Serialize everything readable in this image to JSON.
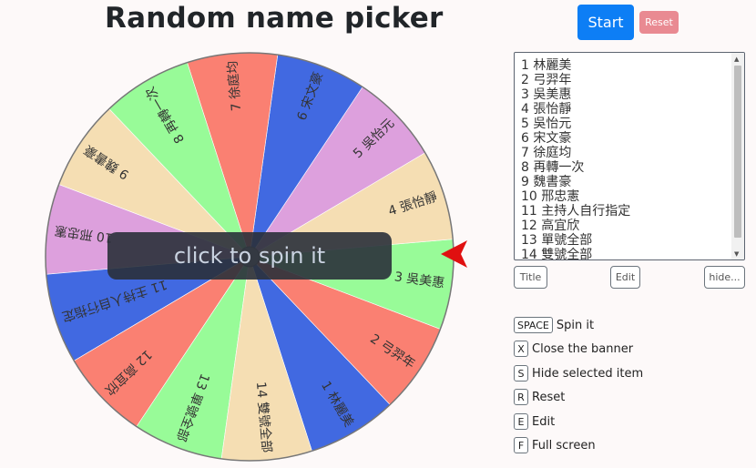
{
  "title": "Random name picker",
  "buttons": {
    "start": "Start",
    "reset": "Reset",
    "title": "Title",
    "edit": "Edit",
    "hide": "hide..."
  },
  "banner": "click to spin it",
  "names": [
    "林麗美",
    "弓羿年",
    "吳美惠",
    "張怡靜",
    "吳怡元",
    "宋文豪",
    "徐庭均",
    "再轉一次",
    "魏書豪",
    "邢忠憲",
    "主持人自行指定",
    "高宜欣",
    "單號全部",
    "雙號全部"
  ],
  "names_text": "1 林麗美\n2 弓羿年\n3 吳美惠\n4 張怡靜\n5 吳怡元\n6 宋文豪\n7 徐庭均\n8 再轉一次\n9 魏書豪\n10 邢忠憲\n11 主持人自行指定\n12 高宜欣\n13 單號全部\n14 雙號全部",
  "wheel": {
    "colors": [
      "#4169e1",
      "#fa8072",
      "#98fb98",
      "#f5deb3",
      "#dda0dd",
      "#4169e1",
      "#fa8072",
      "#98fb98",
      "#f5deb3",
      "#dda0dd",
      "#4169e1",
      "#fa8072",
      "#98fb98",
      "#f5deb3"
    ],
    "labels": [
      "1 林麗美",
      "2 弓羿年",
      "3 吳美惠",
      "4 張怡靜",
      "5 吳怡元",
      "6 宋文豪",
      "7 徐庭均",
      "8 再轉一次",
      "9 魏書豪",
      "10 邢忠憲",
      "11 主持人自行指定",
      "12 高宜欣",
      "13 單號全部",
      "14 雙號全部"
    ],
    "pointer_color": "#e01010"
  },
  "shortcuts": [
    {
      "key": "SPACE",
      "label": "Spin it"
    },
    {
      "key": "X",
      "label": "Close the banner"
    },
    {
      "key": "S",
      "label": "Hide selected item"
    },
    {
      "key": "R",
      "label": "Reset"
    },
    {
      "key": "E",
      "label": "Edit"
    },
    {
      "key": "F",
      "label": "Full screen"
    }
  ]
}
